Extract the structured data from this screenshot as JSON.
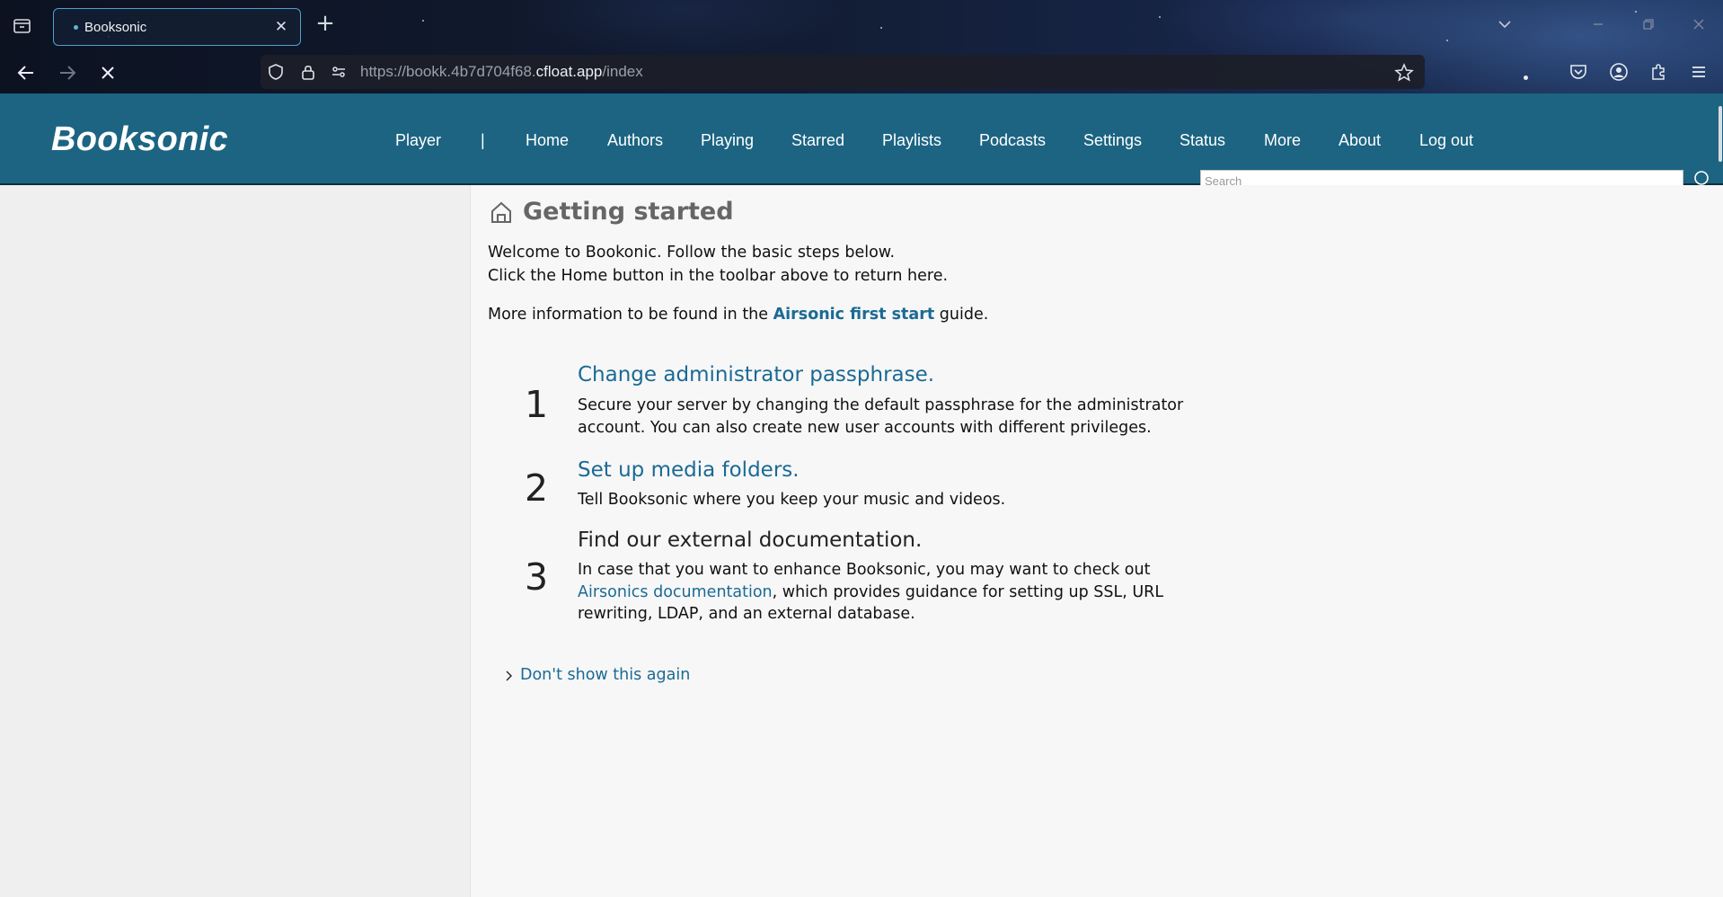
{
  "browser": {
    "tab_title": "Booksonic",
    "url_prefix": "https://bookk.4b7d704f68.",
    "url_host": "cfloat.app",
    "url_path": "/index",
    "close_glyph": "✕",
    "new_tab_glyph": "+"
  },
  "header": {
    "logo": "Booksonic",
    "nav": [
      "Player",
      "|",
      "Home",
      "Authors",
      "Playing",
      "Starred",
      "Playlists",
      "Podcasts",
      "Settings",
      "Status",
      "More",
      "About",
      "Log out"
    ],
    "search_placeholder": "Search",
    "bg_color": "#1c6482"
  },
  "main": {
    "title": "Getting started",
    "welcome_line1": "Welcome to Bookonic. Follow the basic steps below.",
    "welcome_line2": "Click the Home button in the toolbar above to return here.",
    "info_prefix": "More information to be found in the ",
    "info_link": "Airsonic first start",
    "info_suffix": " guide.",
    "steps": [
      {
        "number": "1",
        "title": "Change administrator passphrase.",
        "desc": "Secure your server by changing the default passphrase for the administrator account. You can also create new user accounts with different privileges."
      },
      {
        "number": "2",
        "title": "Set up media folders.",
        "desc": "Tell Booksonic where you keep your music and videos."
      },
      {
        "number": "3",
        "title": "Find our external documentation.",
        "desc_prefix": "In case that you want to enhance Booksonic, you may want to check out ",
        "desc_link": "Airsonics documentation",
        "desc_suffix": ", which provides guidance for setting up SSL, URL rewriting, LDAP, and an external database."
      }
    ],
    "dont_show": "Don't show this again",
    "link_color": "#1b6a94"
  }
}
